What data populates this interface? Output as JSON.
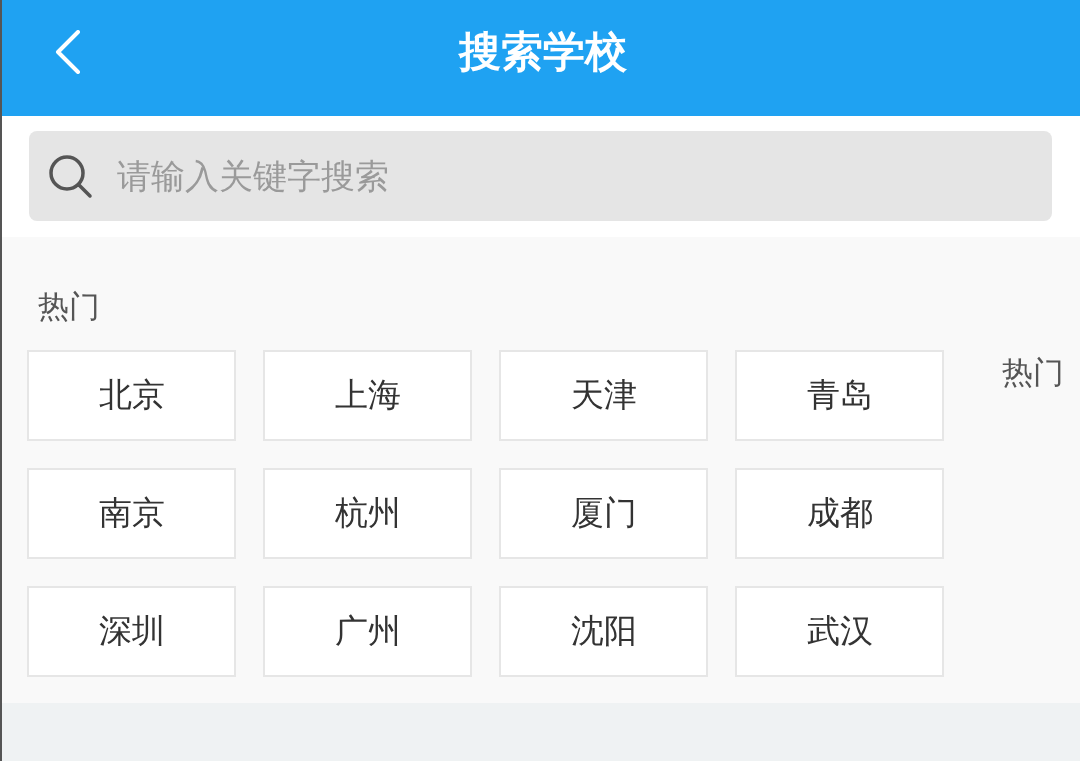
{
  "header": {
    "title": "搜索学校"
  },
  "search": {
    "placeholder": "请输入关键字搜索"
  },
  "hot_section": {
    "heading": "热门",
    "cities": [
      "北京",
      "上海",
      "天津",
      "青岛",
      "南京",
      "杭州",
      "厦门",
      "成都",
      "深圳",
      "广州",
      "沈阳",
      "武汉"
    ]
  },
  "index_bar": {
    "items": [
      "热门"
    ]
  }
}
